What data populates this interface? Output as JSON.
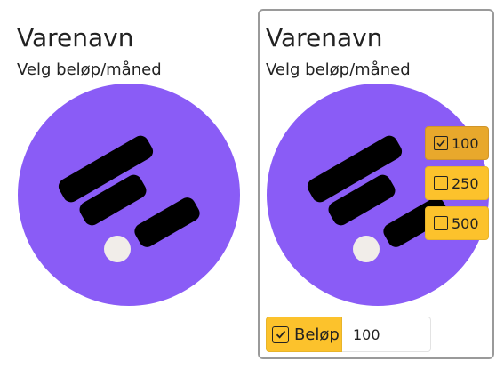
{
  "colors": {
    "logo_circle": "#8a5cf6",
    "logo_bars": "#000000",
    "logo_dot": "#f1ede9",
    "option_bg": "#fcc22c",
    "option_selected_bg": "#e8a82c",
    "card_border": "#9a9a9a"
  },
  "left_card": {
    "title": "Varenavn",
    "subtitle": "Velg beløp/måned"
  },
  "right_card": {
    "title": "Varenavn",
    "subtitle": "Velg beløp/måned",
    "options": [
      {
        "label": "100",
        "checked": true
      },
      {
        "label": "250",
        "checked": false
      },
      {
        "label": "500",
        "checked": false
      }
    ],
    "amount": {
      "label": "Beløp",
      "checked": true,
      "value": "100"
    }
  },
  "icons": {
    "logo": "brand-logo-icon",
    "checked": "checkbox-checked-icon",
    "unchecked": "checkbox-empty-icon"
  }
}
